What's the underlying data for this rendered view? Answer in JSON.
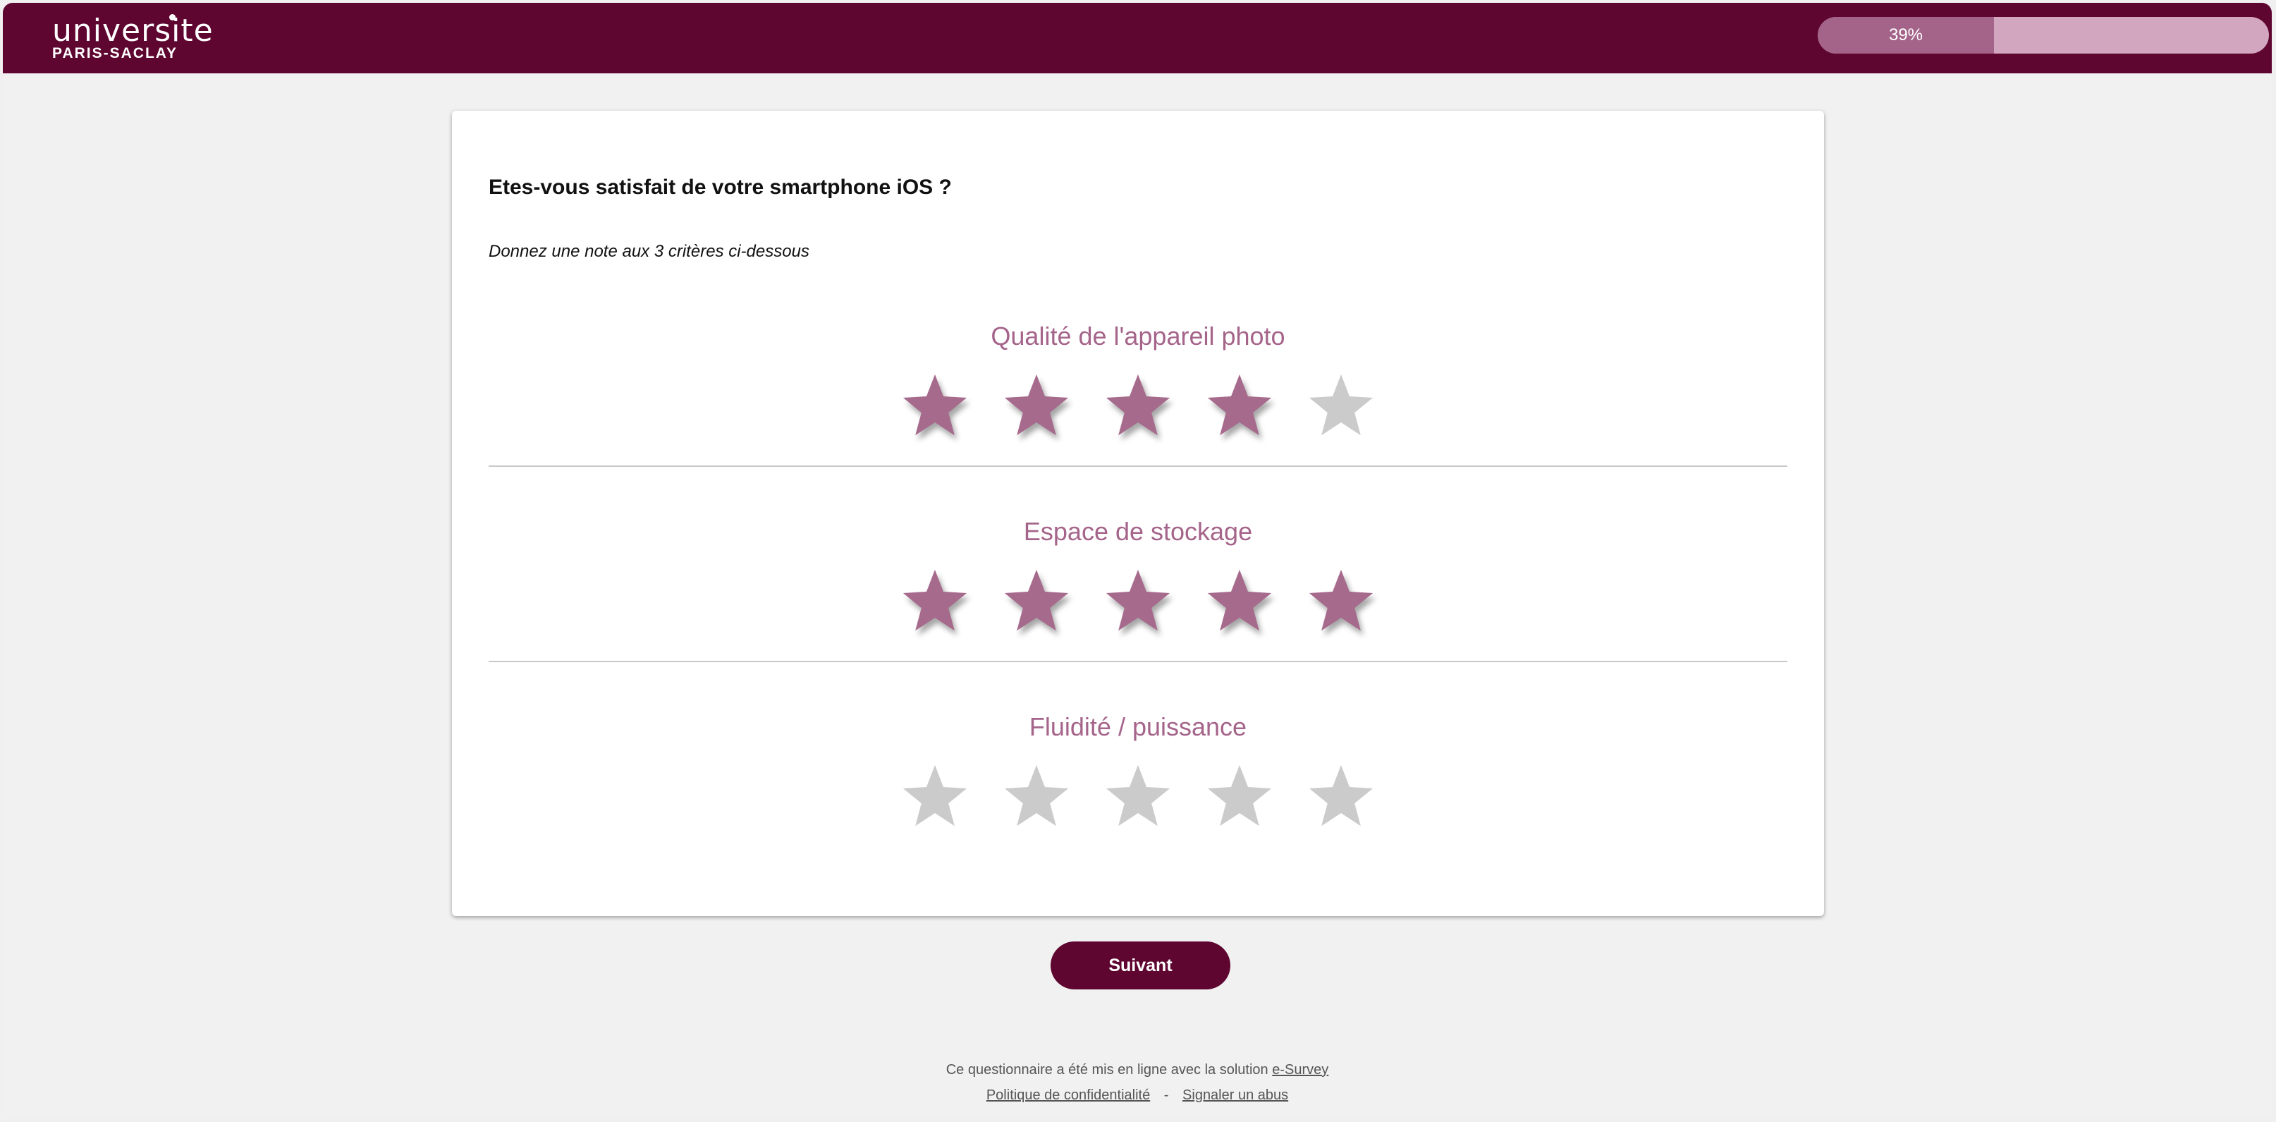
{
  "brand": {
    "logo_line1": "universite",
    "logo_line2": "PARIS-SACLAY",
    "header_color": "#5e0530"
  },
  "progress": {
    "value": 0.39,
    "label": "39%",
    "fill_color": "#a4648a",
    "track_color": "#d2a6bf"
  },
  "survey": {
    "question": "Etes-vous satisfait de votre smartphone iOS ?",
    "instruction": "Donnez une note aux 3 critères ci-dessous",
    "max_rating": 5,
    "filled_color": "#a66a8c",
    "empty_color": "#cbcbcb",
    "criteria": [
      {
        "label": "Qualité de l'appareil photo",
        "rating": 4
      },
      {
        "label": "Espace de stockage",
        "rating": 5
      },
      {
        "label": "Fluidité / puissance",
        "rating": 0
      }
    ]
  },
  "actions": {
    "next_label": "Suivant"
  },
  "footer": {
    "credit_text": "Ce questionnaire a été mis en ligne avec la solution",
    "credit_link": "e-Survey",
    "privacy_link": "Politique de confidentialité",
    "separator": "-",
    "report_link": "Signaler un abus"
  }
}
